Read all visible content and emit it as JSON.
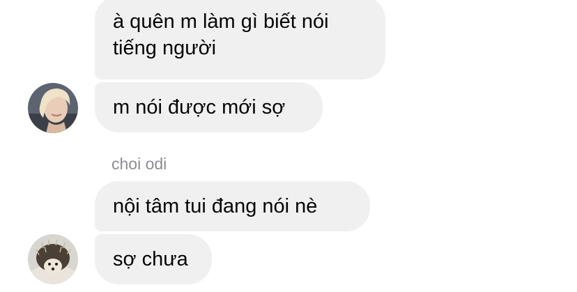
{
  "thread": {
    "messages": [
      {
        "text": "à quên m làm gì biết nói tiếng người"
      },
      {
        "text": "m nói được mới sợ"
      },
      {
        "text": "nội tâm tui đang nói nè"
      },
      {
        "text": "sợ chưa"
      }
    ],
    "group2_sender": "choi odi"
  },
  "avatars": {
    "first": "blonde-person-avatar-icon",
    "second": "hedgehog-avatar-icon"
  }
}
